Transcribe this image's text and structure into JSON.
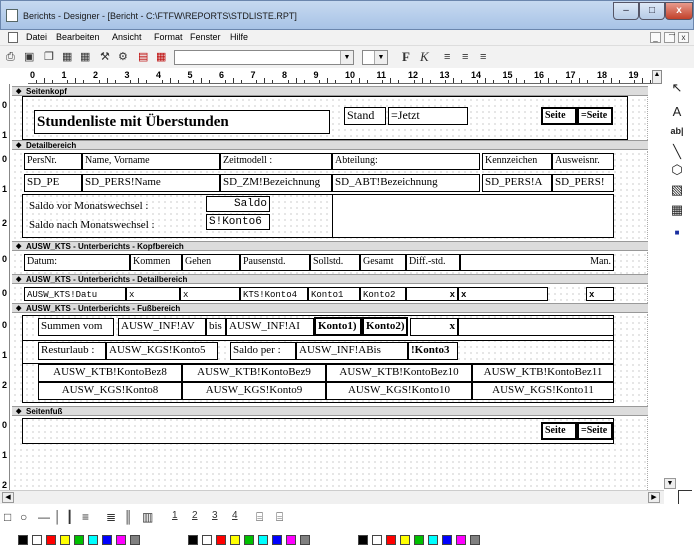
{
  "window": {
    "title": "Berichts - Designer - [Bericht - C:\\FTFW\\REPORTS\\STDLISTE.RPT]",
    "min": "–",
    "max": "□",
    "close": "x"
  },
  "menu": [
    "Datei",
    "Bearbeiten",
    "Ansicht",
    "Format",
    "Fenster",
    "Hilfe"
  ],
  "mdi": {
    "min": "_",
    "restore": "͠",
    "close": "x"
  },
  "toolbar": {
    "bold": "F",
    "italic": "K",
    "font_combo": "",
    "size_combo": ""
  },
  "ruler": [
    "0",
    "1",
    "2",
    "3",
    "4",
    "5",
    "6",
    "7",
    "8",
    "9",
    "10",
    "11",
    "12",
    "13",
    "14",
    "15",
    "16",
    "17",
    "18",
    "19"
  ],
  "left_ruler": {
    "kopf": [
      "0",
      "1"
    ],
    "detail": [
      "0",
      "1",
      "2"
    ],
    "kts_kopf": [
      "0"
    ],
    "kts_detail": [
      "0"
    ],
    "kts_fuss": [
      "0",
      "1",
      "2"
    ],
    "fuss": [
      "0",
      "1",
      "2"
    ]
  },
  "bands": {
    "seitenkopf": "Seitenkopf",
    "detail": "Detailbereich",
    "kts_kopf": "AUSW_KTS - Unterberichts - Kopfbereich",
    "kts_detail": "AUSW_KTS - Unterberichts - Detailbereich",
    "kts_fuss": "AUSW_KTS - Unterberichts - Fußbereich",
    "seitenfuss": "Seitenfuß"
  },
  "fields": {
    "title": "Stundenliste mit Überstunden",
    "stand": "Stand",
    "jetzt": "=Jetzt",
    "seite_label": "Seite",
    "seite_val": "=Seite",
    "h_persnr": "PersNr.",
    "h_name": "Name, Vorname",
    "h_zeitmodell": "Zeitmodell :",
    "h_abteilung": "Abteilung:",
    "h_kennzeichen": "Kennzeichen",
    "h_ausweis": "Ausweisnr.",
    "d_pe": "SD_PE",
    "d_name": "SD_PERS!Name",
    "d_zm": "SD_ZM!Bezeichnung",
    "d_abt": "SD_ABT!Bezeichnung",
    "d_kz": "SD_PERS!A",
    "d_aw": "SD_PERS!",
    "saldo_vor": "Saldo vor  Monatswechsel :",
    "saldo_nach": "Saldo nach Monatswechsel :",
    "saldo": "Saldo",
    "konto6": "S!Konto6",
    "k_datum": "Datum:",
    "k_kommen": "Kommen",
    "k_gehen": "Gehen",
    "k_pause": "Pausenstd.",
    "k_soll": "Sollstd.",
    "k_gesamt": "Gesamt",
    "k_diff": "Diff.-std.",
    "k_man": "Man.",
    "dt_datum": "AUSW_KTS!Datu",
    "dt_x1": "x",
    "dt_x2": "x",
    "dt_k4": "KTS!Konto4",
    "dt_k1": "Konto1",
    "dt_k2": "Konto2",
    "dt_x3": "x",
    "dt_x4": "x",
    "dt_x5": "x",
    "f_summen": "Summen vom",
    "f_av": "AUSW_INF!AV",
    "f_bis": "bis",
    "f_ab": "AUSW_INF!AI",
    "f_k1": "Konto1)",
    "f_k2": "Konto2)",
    "f_x": "x",
    "f_rest": "Resturlaub :",
    "f_kgs5": "AUSW_KGS!Konto5",
    "f_saldoper": "Saldo per :",
    "f_abis": "AUSW_INF!ABis",
    "f_k3": "!Konto3",
    "f_b8": "AUSW_KTB!KontoBez8",
    "f_b9": "AUSW_KTB!KontoBez9",
    "f_b10": "AUSW_KTB!KontoBez10",
    "f_b11": "AUSW_KTB!KontoBez11",
    "f_g8": "AUSW_KGS!Konto8",
    "f_g9": "AUSW_KGS!Konto9",
    "f_g10": "AUSW_KGS!Konto10",
    "f_g11": "AUSW_KGS!Konto11",
    "fs_seite": "Seite",
    "fs_seiteval": "=Seite"
  },
  "palette": [
    "pointer-icon",
    "text-tool-icon",
    "field-tool-icon",
    "line-tool-icon",
    "shape-tool-icon",
    "image-tool-icon",
    "subreport-tool-icon",
    "lock-icon"
  ],
  "palette_glyphs": [
    "↖",
    "A",
    "ab|",
    "╲",
    "⬡",
    "▧",
    "▦",
    "■"
  ],
  "drawtools": [
    "□",
    "○",
    "—",
    "│",
    "┃",
    "≡",
    "≣",
    "║",
    "▥",
    "1",
    "2",
    "3",
    "4",
    "⌸",
    "⌸"
  ],
  "colors": [
    "#000000",
    "#ffffff",
    "#ff0000",
    "#ffff00",
    "#00c000",
    "#00ffff",
    "#0000ff",
    "#ff00ff",
    "#808080",
    "#000000",
    "#ffffff",
    "#ff0000",
    "#ffff00",
    "#00c000",
    "#00ffff",
    "#0000ff",
    "#ff00ff",
    "#808080",
    "#000000",
    "#ffffff",
    "#ff0000",
    "#ffff00",
    "#00c000",
    "#00ffff",
    "#0000ff",
    "#ff00ff",
    "#808080"
  ]
}
